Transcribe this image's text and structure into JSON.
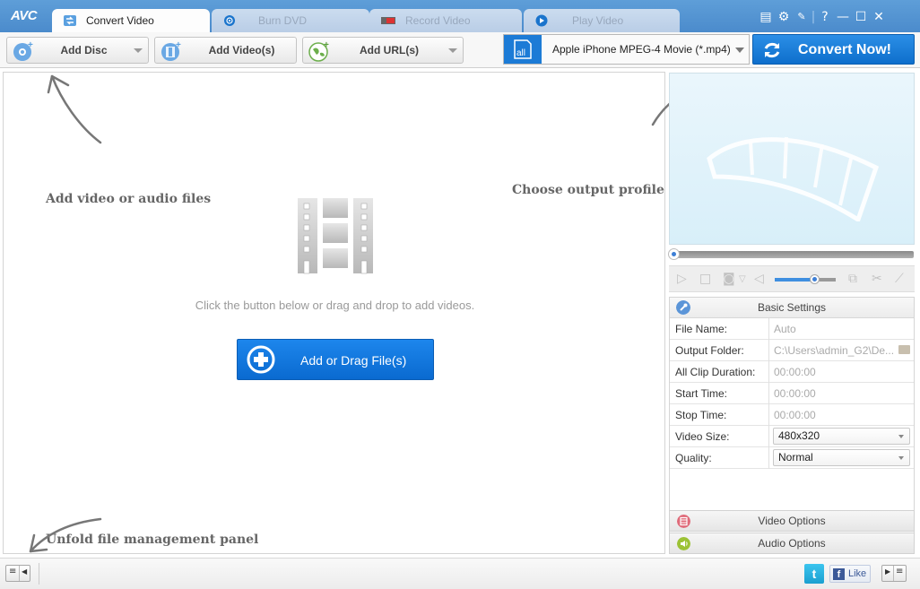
{
  "app": {
    "logo": "AVC",
    "brand_color": "#4b8bcc",
    "accent_color": "#1c7bd6"
  },
  "tabs": [
    {
      "label": "Convert Video",
      "icon": "convert-icon",
      "active": true
    },
    {
      "label": "Burn DVD",
      "icon": "disc-icon",
      "active": false
    },
    {
      "label": "Record Video",
      "icon": "record-icon",
      "active": false
    },
    {
      "label": "Play Video",
      "icon": "play-icon",
      "active": false
    }
  ],
  "window_controls": [
    {
      "name": "skin-icon",
      "glyph": "▤"
    },
    {
      "name": "settings-icon",
      "glyph": "⚙"
    },
    {
      "name": "key-icon",
      "glyph": "🔑"
    },
    {
      "name": "help-icon",
      "glyph": "?"
    },
    {
      "name": "minimize-icon",
      "glyph": "—"
    },
    {
      "name": "maximize-icon",
      "glyph": "☐"
    },
    {
      "name": "close-icon",
      "glyph": "✕"
    }
  ],
  "toolbar": {
    "add_disc": "Add Disc",
    "add_videos": "Add Video(s)",
    "add_url": "Add URL(s)",
    "profile": "Apple iPhone MPEG-4 Movie (*.mp4)",
    "profile_icon_text": "all",
    "convert": "Convert Now!"
  },
  "main": {
    "hint_add": "Add video or audio files",
    "hint_profile": "Choose output profile and convert",
    "hint_unfold": "Unfold file management panel",
    "drop_text": "Click the button below or drag and drop to add videos.",
    "add_button": "Add or Drag File(s)"
  },
  "player": {
    "seek_fraction": 0.0,
    "volume_fraction": 0.5
  },
  "settings": {
    "title": "Basic Settings",
    "rows": [
      {
        "label": "File Name:",
        "value": "Auto",
        "type": "text"
      },
      {
        "label": "Output Folder:",
        "value": "C:\\Users\\admin_G2\\De...",
        "type": "folder"
      },
      {
        "label": "All Clip Duration:",
        "value": "00:00:00",
        "type": "text"
      },
      {
        "label": "Start Time:",
        "value": "00:00:00",
        "type": "text"
      },
      {
        "label": "Stop Time:",
        "value": "00:00:00",
        "type": "text"
      },
      {
        "label": "Video Size:",
        "value": "480x320",
        "type": "select"
      },
      {
        "label": "Quality:",
        "value": "Normal",
        "type": "select"
      }
    ],
    "video_options": "Video Options",
    "audio_options": "Audio Options"
  },
  "statusbar": {
    "like": "Like",
    "twitter": "t",
    "facebook": "f"
  }
}
